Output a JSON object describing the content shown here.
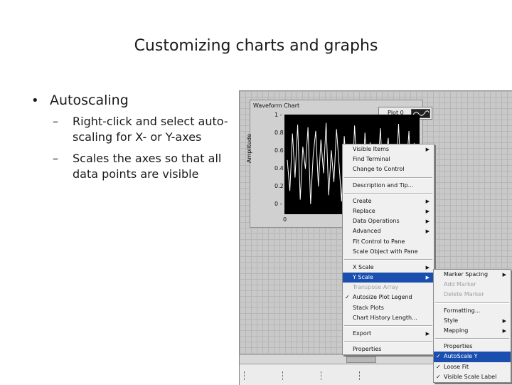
{
  "slide": {
    "title": "Customizing charts and graphs",
    "bullet": "Autoscaling",
    "sub_bullets": [
      "Right-click and select auto-scaling for X- or Y-axes",
      "Scales the axes so that all data points are visible"
    ],
    "bullet_glyph": "•",
    "dash_glyph": "–"
  },
  "chart": {
    "label": "Waveform Chart",
    "legend_plot": "Plot 0",
    "y_axis_title": "Amplitude",
    "y_ticks": [
      "1 -",
      "0.8 -",
      "0.6 -",
      "0.4 -",
      "0.2 -",
      "0 -"
    ],
    "x_tick": "0"
  },
  "context_menu": [
    {
      "label": "Visible Items",
      "sub": true,
      "group": 1
    },
    {
      "label": "Find Terminal",
      "group": 1
    },
    {
      "label": "Change to Control",
      "group": 1
    },
    {
      "label": "Description and Tip...",
      "group": 2
    },
    {
      "label": "Create",
      "sub": true,
      "group": 3
    },
    {
      "label": "Replace",
      "sub": true,
      "group": 3
    },
    {
      "label": "Data Operations",
      "sub": true,
      "group": 3
    },
    {
      "label": "Advanced",
      "sub": true,
      "group": 3
    },
    {
      "label": "Fit Control to Pane",
      "group": 3
    },
    {
      "label": "Scale Object with Pane",
      "group": 3
    },
    {
      "label": "X Scale",
      "sub": true,
      "group": 4
    },
    {
      "label": "Y Scale",
      "sub": true,
      "group": 4,
      "highlighted": true
    },
    {
      "label": "Transpose Array",
      "group": 4,
      "disabled": true
    },
    {
      "label": "Autosize Plot Legend",
      "group": 4,
      "checked": true
    },
    {
      "label": "Stack Plots",
      "group": 4
    },
    {
      "label": "Chart History Length...",
      "group": 4
    },
    {
      "label": "Export",
      "sub": true,
      "group": 5
    },
    {
      "label": "Properties",
      "group": 6
    }
  ],
  "submenu": [
    {
      "label": "Marker Spacing",
      "sub": true,
      "group": 1
    },
    {
      "label": "Add Marker",
      "group": 1,
      "disabled": true
    },
    {
      "label": "Delete Marker",
      "group": 1,
      "disabled": true
    },
    {
      "label": "Formatting...",
      "group": 2
    },
    {
      "label": "Style",
      "sub": true,
      "group": 2
    },
    {
      "label": "Mapping",
      "sub": true,
      "group": 2
    },
    {
      "label": "Properties",
      "group": 3
    },
    {
      "label": "AutoScale Y",
      "group": 3,
      "checked": true,
      "highlighted": true
    },
    {
      "label": "Loose Fit",
      "group": 3,
      "checked": true
    },
    {
      "label": "Visible Scale Label",
      "group": 3,
      "checked": true
    }
  ],
  "glyphs": {
    "check": "✓",
    "arrow": "▶"
  },
  "colors": {
    "highlight": "#1a4fb0",
    "plot_bg": "#000000",
    "trace": "#ffffff"
  },
  "waveform": [
    0.55,
    0.2,
    0.85,
    0.35,
    0.95,
    0.1,
    0.7,
    0.45,
    0.92,
    0.05,
    0.6,
    0.88,
    0.25,
    0.78,
    0.4,
    0.97,
    0.15,
    0.66,
    0.3,
    0.9,
    0.5,
    0.08,
    0.82,
    0.38,
    0.72,
    0.18,
    0.94,
    0.42,
    0.6,
    0.12,
    0.86,
    0.33,
    0.75,
    0.02,
    0.68,
    0.48,
    0.91,
    0.22,
    0.58,
    0.8,
    0.1,
    0.7,
    0.36,
    0.96,
    0.26,
    0.64,
    0.44,
    0.88,
    0.06,
    0.74,
    0.52
  ]
}
